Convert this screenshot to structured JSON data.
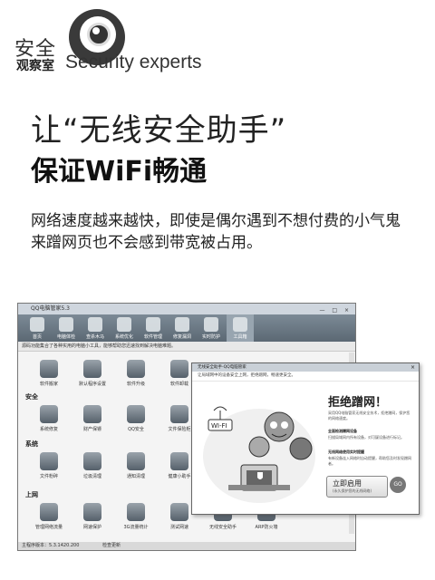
{
  "header": {
    "safe": "安全",
    "observatory": "观察室",
    "security_experts": "Security experts"
  },
  "article": {
    "title_line1": "让“无线安全助手”",
    "title_line2": "保证WiFi畅通",
    "lead": "网络速度越来越快，即使是偶尔遇到不想付费的小气鬼来蹭网页也不会感到带宽被占用。"
  },
  "screenshot": {
    "window_title": "QQ电脑管家5.3",
    "toolbar": [
      "首页",
      "电脑体检",
      "查杀木马",
      "系统优化",
      "软件管理",
      "修复漏洞",
      "实时防护",
      "工具箱"
    ],
    "info": "源码功能集合了各种实用的电脑小工具，能够帮助您迅速找到解决电脑难题。",
    "sections": [
      {
        "label": "",
        "items": [
          "软件搬家",
          "默认程序设置",
          "软件升级",
          "软件卸载"
        ]
      },
      {
        "label": "安全",
        "items": [
          "系统修复",
          "财产保镖",
          "QQ安全",
          "文件保险柜"
        ]
      },
      {
        "label": "系统",
        "items": [
          "文件粉碎",
          "垃圾清理",
          "通知清理",
          "健康小助手"
        ]
      },
      {
        "label": "上网",
        "items": [
          "管理网络流量",
          "网速保护",
          "3G流量统计",
          "测试网速",
          "无线安全助手",
          "ARP防火墙"
        ]
      }
    ],
    "status_left": "主程序版本：5.3.1420.200",
    "status_right": "检查更新",
    "dialog": {
      "title": "无线安全助手-QQ电脑管家",
      "subtitle": "让局域网中的设备安全上网，拒绝蹭网，畅速更安全。",
      "refuse": "拒绝蹭网！",
      "desc": "采用QQ电脑管家无线安全技术，拒绝蹭网，保护您的网络速度。",
      "feature1": "全面检测蹭网设备",
      "feature1_desc": "扫描局域网内所有设备，对可疑设备进行标记。",
      "feature2": "无线网络使用实时提醒",
      "feature2_desc": "有新设备连入网络时自动提醒，帮助您及时发现蹭网者。",
      "enable": "立即启用",
      "enable_sub": "(永久保护您的无线网络)",
      "go": "GO",
      "wifi_label": "WI-FI"
    }
  }
}
